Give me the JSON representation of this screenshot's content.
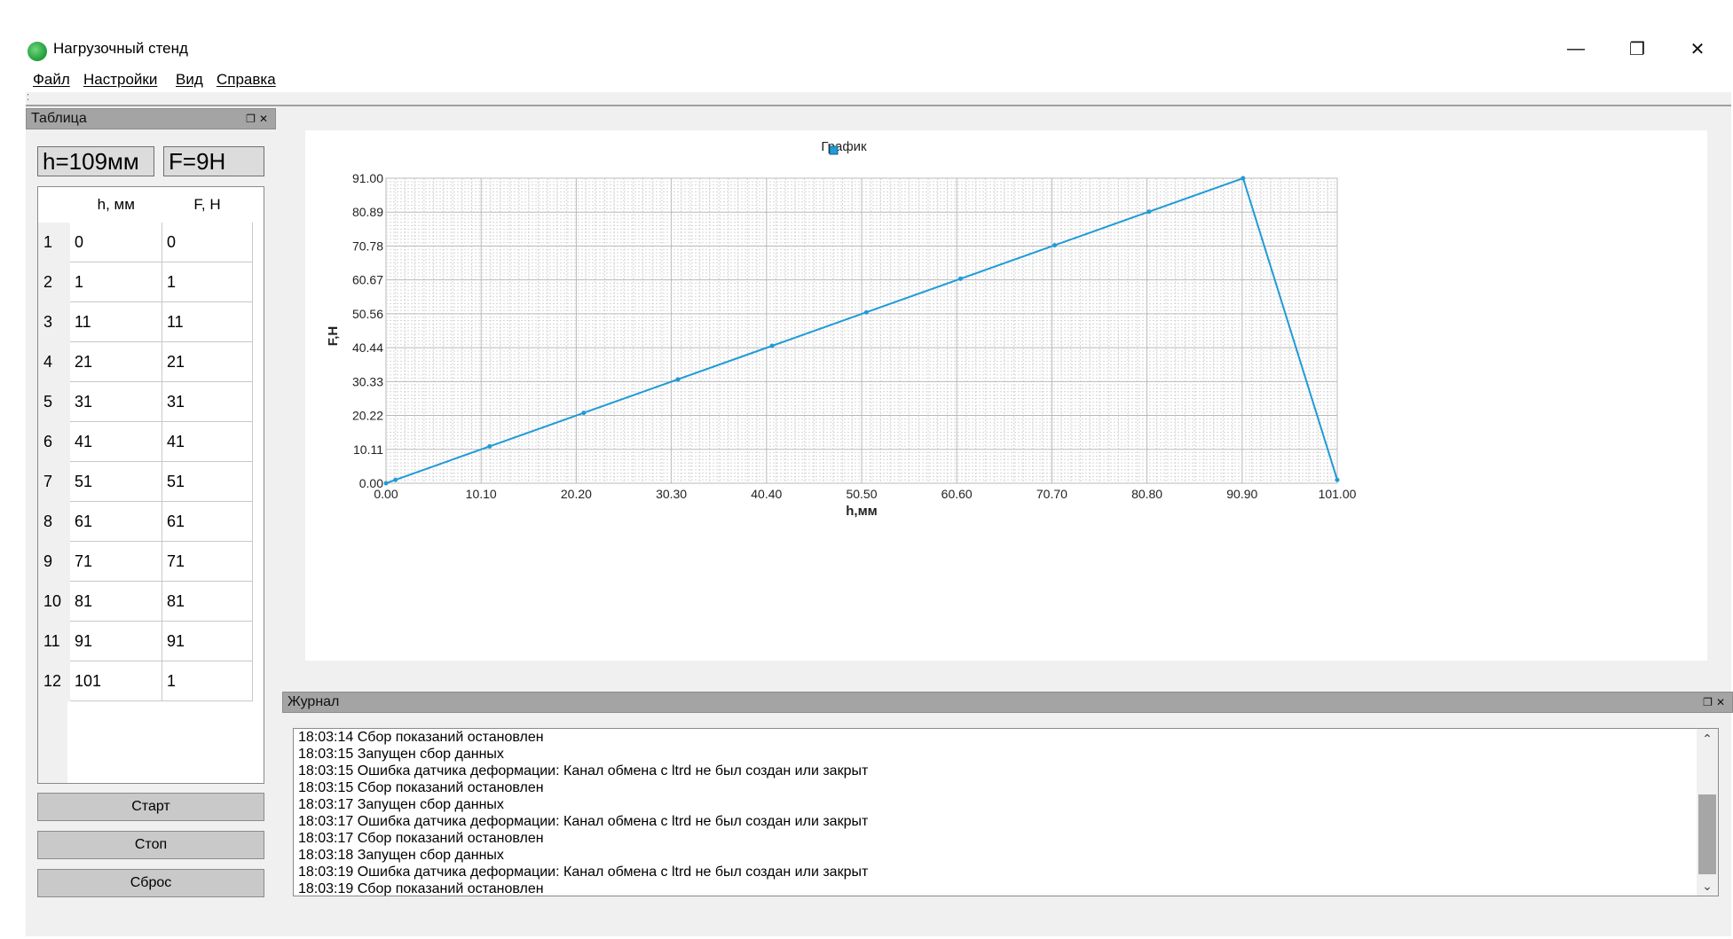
{
  "window": {
    "title": "Нагрузочный стенд",
    "min_glyph": "—",
    "max_glyph": "❐",
    "close_glyph": "✕"
  },
  "menu": [
    "Файл",
    "Настройки",
    "Вид",
    "Справка"
  ],
  "left_dock": {
    "title": "Таблица",
    "float_glyph": "❐",
    "close_glyph": "✕",
    "h_readout": "h=109мм",
    "f_readout": "F=9Н",
    "columns": [
      "h, мм",
      "F, Н"
    ],
    "rows": [
      {
        "n": "1",
        "h": "0",
        "f": "0"
      },
      {
        "n": "2",
        "h": "1",
        "f": "1"
      },
      {
        "n": "3",
        "h": "11",
        "f": "11"
      },
      {
        "n": "4",
        "h": "21",
        "f": "21"
      },
      {
        "n": "5",
        "h": "31",
        "f": "31"
      },
      {
        "n": "6",
        "h": "41",
        "f": "41"
      },
      {
        "n": "7",
        "h": "51",
        "f": "51"
      },
      {
        "n": "8",
        "h": "61",
        "f": "61"
      },
      {
        "n": "9",
        "h": "71",
        "f": "71"
      },
      {
        "n": "10",
        "h": "81",
        "f": "81"
      },
      {
        "n": "11",
        "h": "91",
        "f": "91"
      },
      {
        "n": "12",
        "h": "101",
        "f": "1"
      }
    ],
    "start_label": "Старт",
    "stop_label": "Стоп",
    "reset_label": "Сброс"
  },
  "chart_data": {
    "type": "line",
    "title": "График",
    "xlabel": "h,мм",
    "ylabel": "F,Н",
    "xlim": [
      0,
      101
    ],
    "ylim": [
      0,
      91
    ],
    "x_ticks": [
      "0.00",
      "10.10",
      "20.20",
      "30.30",
      "40.40",
      "50.50",
      "60.60",
      "70.70",
      "80.80",
      "90.90",
      "101.00"
    ],
    "y_ticks": [
      "0.00",
      "10.11",
      "20.22",
      "30.33",
      "40.44",
      "50.56",
      "60.67",
      "70.78",
      "80.89",
      "91.00"
    ],
    "grid": true,
    "legend": "top-center",
    "series": [
      {
        "color": "#1f9bd7",
        "x": [
          0,
          1,
          11,
          21,
          31,
          41,
          51,
          61,
          71,
          81,
          91,
          101
        ],
        "y": [
          0,
          1,
          11,
          21,
          31,
          41,
          51,
          61,
          71,
          81,
          91,
          1
        ]
      }
    ]
  },
  "journal": {
    "title": "Журнал",
    "float_glyph": "❐",
    "close_glyph": "✕",
    "lines": [
      "18:03:14 Сбор показаний остановлен",
      "18:03:15 Запущен сбор данных",
      "18:03:15 Ошибка датчика деформации: Канал обмена с ltrd не был создан или закрыт",
      "18:03:15 Сбор показаний остановлен",
      "18:03:17 Запущен сбор данных",
      "18:03:17 Ошибка датчика деформации: Канал обмена с ltrd не был создан или закрыт",
      "18:03:17 Сбор показаний остановлен",
      "18:03:18 Запущен сбор данных",
      "18:03:19 Ошибка датчика деформации: Канал обмена с ltrd не был создан или закрыт",
      "18:03:19 Сбор показаний остановлен"
    ]
  }
}
